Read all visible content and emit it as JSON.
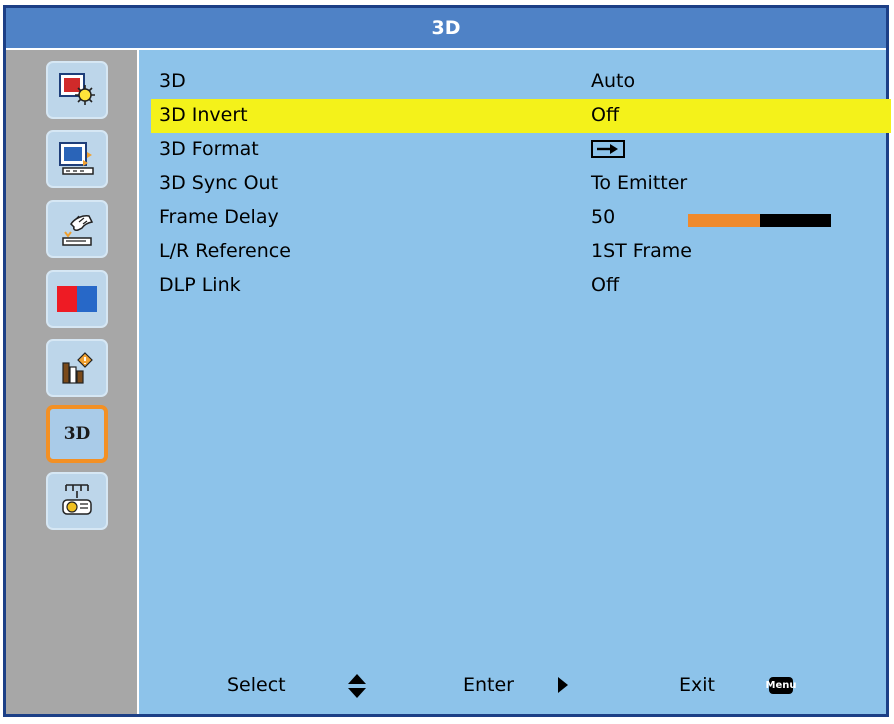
{
  "title": "3D",
  "sidebar": [
    {
      "icon": "image-settings-icon"
    },
    {
      "icon": "display-settings-icon"
    },
    {
      "icon": "setup-icon"
    },
    {
      "icon": "color-settings-icon",
      "colors": [
        "#ee1b24",
        "#2768c8"
      ]
    },
    {
      "icon": "info-icon"
    },
    {
      "icon": "3d-icon",
      "label": "3D",
      "active": true
    },
    {
      "icon": "network-icon"
    }
  ],
  "menu": [
    {
      "label": "3D",
      "value": "Auto"
    },
    {
      "label": "3D Invert",
      "value": "Off",
      "highlighted": true
    },
    {
      "label": "3D Format",
      "value_icon": "right-arrow-icon"
    },
    {
      "label": "3D Sync Out",
      "value": "To Emitter"
    },
    {
      "label": "Frame Delay",
      "value": "50",
      "slider_fraction": 0.5
    },
    {
      "label": "L/R Reference",
      "value": "1ST Frame"
    },
    {
      "label": "DLP Link",
      "value": "Off"
    }
  ],
  "footer": {
    "select": "Select",
    "enter": "Enter",
    "exit": "Exit",
    "menu_key": "Menu"
  },
  "colors": {
    "background": "#8dc3ea",
    "title_bar": "#4f82c6",
    "highlight": "#f4f21a",
    "slider_fill": "#f08a2c",
    "active_border": "#f39024"
  }
}
